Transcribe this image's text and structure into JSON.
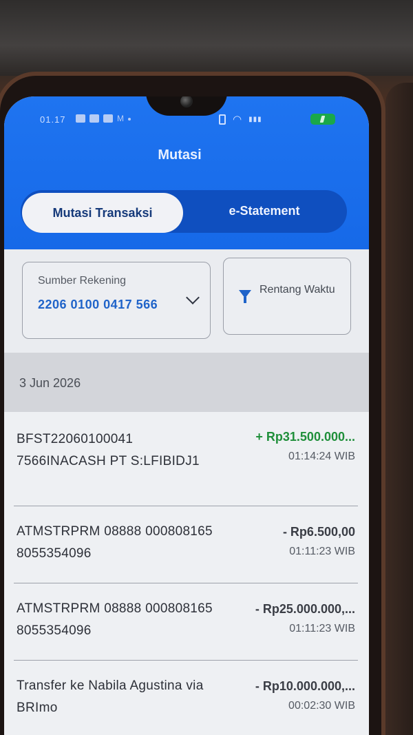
{
  "status_bar": {
    "time": "01.17",
    "notification_icons": "M"
  },
  "header": {
    "title": "Mutasi"
  },
  "tabs": [
    {
      "label": "Mutasi Transaksi",
      "active": true
    },
    {
      "label": "e-Statement",
      "active": false
    }
  ],
  "account_selector": {
    "label": "Sumber Rekening",
    "account_number": "2206 0100 0417 566"
  },
  "date_range_filter": {
    "label": "Rentang Waktu"
  },
  "date_header": "3 Jun 2026",
  "transactions": [
    {
      "description": "BFST22060100041 7566INACASH PT S:LFIBIDJ1",
      "amount": "+ Rp31.500.000...",
      "time": "01:14:24 WIB",
      "type": "credit"
    },
    {
      "description": "ATMSTRPRM 08888 000808165 8055354096",
      "amount": "- Rp6.500,00",
      "time": "01:11:23 WIB",
      "type": "debit"
    },
    {
      "description": "ATMSTRPRM 08888 000808165 8055354096",
      "amount": "- Rp25.000.000,...",
      "time": "01:11:23 WIB",
      "type": "debit"
    },
    {
      "description": "Transfer ke Nabila Agustina via BRImo",
      "amount": "- Rp10.000.000,...",
      "time": "00:02:30 WIB",
      "type": "debit"
    }
  ],
  "colors": {
    "header_blue": "#1f74f0",
    "tab_blue": "#0f4fbf",
    "credit_green": "#1f8f3a",
    "account_blue": "#1f63c9"
  }
}
